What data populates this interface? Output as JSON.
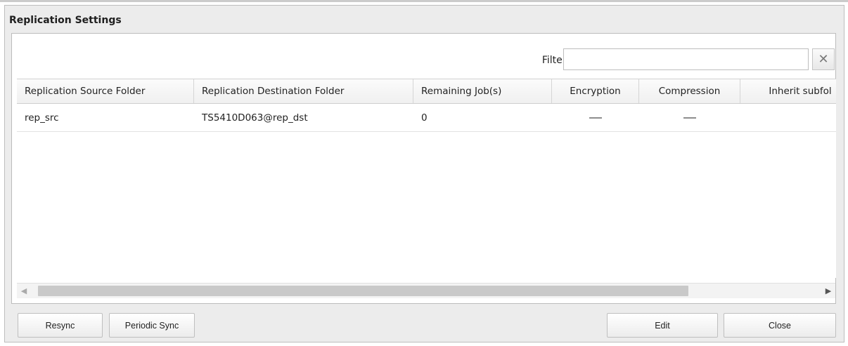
{
  "dialog": {
    "title": "Replication Settings"
  },
  "filter": {
    "label": "Filter:",
    "value": "",
    "placeholder": "",
    "clear_icon": "close-icon",
    "clear_glyph": "✕"
  },
  "table": {
    "columns": [
      "Replication Source Folder",
      "Replication Destination Folder",
      "Remaining Job(s)",
      "Encryption",
      "Compression",
      "Inherit subfol"
    ],
    "rows": [
      {
        "source": "rep_src",
        "destination": "TS5410D063@rep_dst",
        "remaining_jobs": "0",
        "encryption": "—",
        "compression": "—",
        "inherit": ""
      }
    ]
  },
  "scrollbar": {
    "left_arrow": "◀",
    "right_arrow": "▶"
  },
  "buttons": {
    "resync": "Resync",
    "periodic_sync": "Periodic Sync",
    "edit": "Edit",
    "close": "Close"
  }
}
